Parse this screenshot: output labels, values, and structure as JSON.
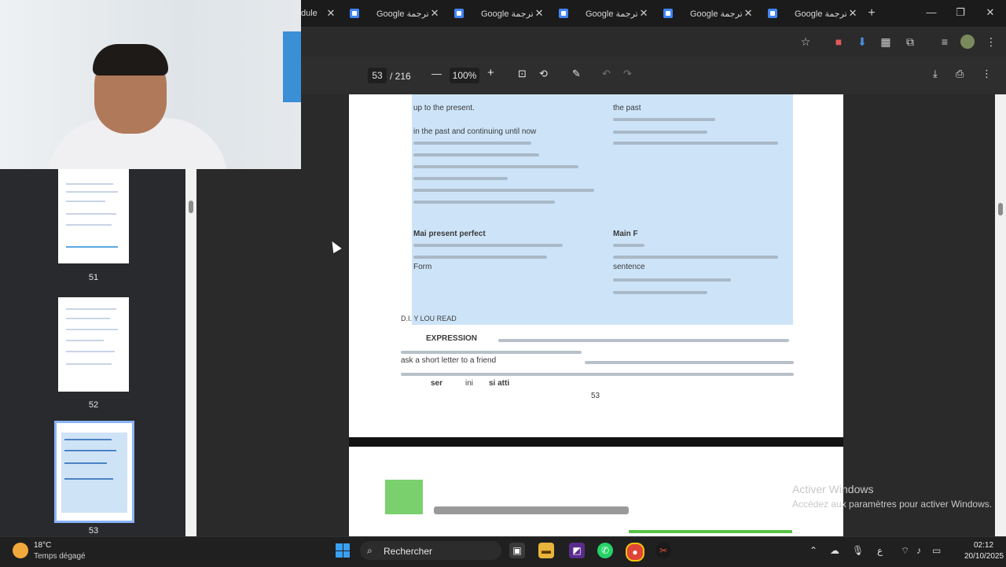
{
  "browser": {
    "first_tab_partial_title": "dule",
    "tabs": [
      {
        "title": "Google ترجمة"
      },
      {
        "title": "Google ترجمة"
      },
      {
        "title": "Google ترجمة"
      },
      {
        "title": "Google ترجمة"
      },
      {
        "title": "Google ترجمة"
      }
    ],
    "new_tab_label": "+",
    "window_controls": {
      "minimize": "—",
      "maximize": "❐",
      "close": "✕"
    }
  },
  "pdf_toolbar": {
    "current_page": "53",
    "total_pages": "/ 216",
    "zoom": "100%",
    "zoom_out": "—",
    "zoom_in": "+"
  },
  "sidebar": {
    "thumbnails": [
      {
        "page": "51"
      },
      {
        "page": "52"
      },
      {
        "page": "53",
        "selected": true
      }
    ]
  },
  "document": {
    "page_number": "53",
    "visible_lines_left": [
      "up to the present.",
      "in the past and continuing until now",
      "Mai   present perfect",
      "Form"
    ],
    "visible_lines_right": [
      "the past",
      "Main   F",
      "sentence"
    ],
    "section_heading": "D.I.  Y  LOU READ",
    "paragraph_words": [
      "EXPRESSION",
      "ask a short letter to a friend",
      "ser",
      "ini",
      "si atti"
    ]
  },
  "watermark": {
    "line1": "Activer Windows",
    "line2": "Accédez aux paramètres pour activer Windows."
  },
  "taskbar": {
    "temperature": "18°C",
    "weather": "Temps dégagé",
    "search_label": "Rechercher",
    "time": "02:12",
    "date": "20/10/2025"
  },
  "colors": {
    "selection": "#cde4f8",
    "accent": "#8ab4f8",
    "windows_blue": "#3aa0f2"
  }
}
